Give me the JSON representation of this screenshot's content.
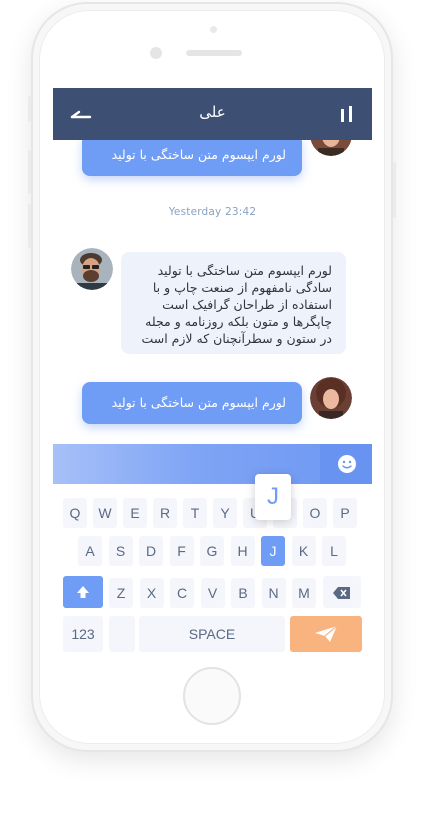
{
  "header": {
    "title": "علی"
  },
  "chat": {
    "messages": [
      {
        "direction": "outgoing",
        "text": "لورم ایپسوم متن ساختگی با تولید"
      },
      {
        "direction": "incoming",
        "lines": [
          "لورم ایپسوم متن ساختگی با تولید",
          "سادگی نامفهوم از صنعت چاپ و با",
          "استفاده از طراحان گرافیک است",
          "چاپگرها و متون بلکه روزنامه و مجله",
          "در ستون و سطرآنچنان که لازم است"
        ]
      },
      {
        "direction": "outgoing",
        "text": "لورم ایپسوم متن ساختگی با تولید"
      }
    ],
    "timestamp": "Yesterday  23:42"
  },
  "keyboard": {
    "row1": [
      "Q",
      "W",
      "E",
      "R",
      "T",
      "Y",
      "U",
      "I",
      "O",
      "P"
    ],
    "row2": [
      "A",
      "S",
      "D",
      "F",
      "G",
      "H",
      "J",
      "K",
      "L"
    ],
    "row3": [
      "Z",
      "X",
      "C",
      "V",
      "B",
      "N",
      "M"
    ],
    "pressed_key": "J",
    "numbers_label": "123",
    "space_label": "SPACE"
  },
  "icons": {
    "back": "back-arrow-icon",
    "menu": "bars-icon",
    "emoji": "smiley-icon",
    "shift": "shift-arrow-icon",
    "delete": "backspace-icon",
    "send": "paper-plane-icon"
  },
  "colors": {
    "header": "#3d4f73",
    "bubble_outgoing": "#6f9cf5",
    "bubble_incoming": "#eef3fb",
    "send_button": "#f9b37e",
    "accent": "#6f9cf5"
  }
}
